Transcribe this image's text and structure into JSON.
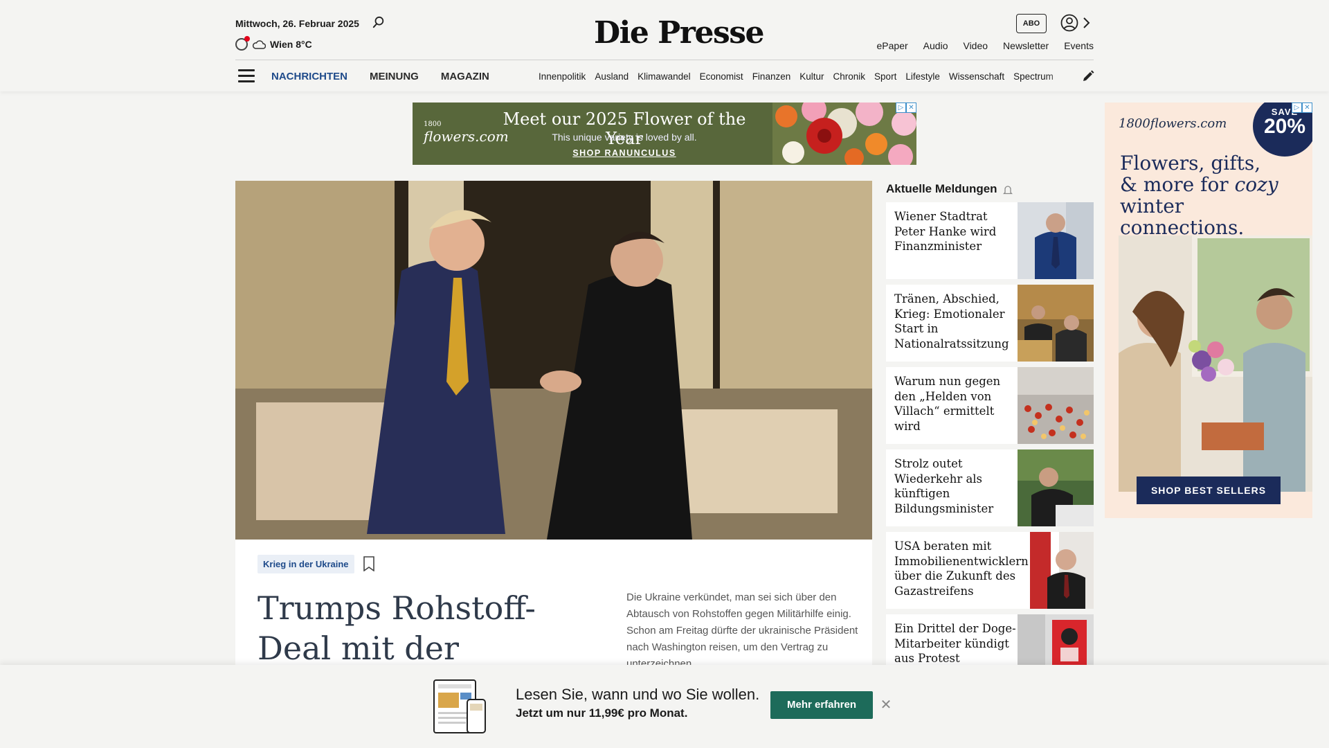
{
  "header": {
    "date": "Mittwoch, 26. Februar 2025",
    "weather": "Wien 8°C",
    "logo": "Die Presse",
    "abo_label": "ABO",
    "top_links": [
      "ePaper",
      "Audio",
      "Video",
      "Newsletter",
      "Events"
    ],
    "main_nav": [
      "NACHRICHTEN",
      "MEINUNG",
      "MAGAZIN"
    ],
    "sub_nav": [
      "Innenpolitik",
      "Ausland",
      "Klimawandel",
      "Economist",
      "Finanzen",
      "Kultur",
      "Chronik",
      "Sport",
      "Lifestyle",
      "Wissenschaft",
      "Spectrum"
    ]
  },
  "top_ad": {
    "brand": "1800flowers.com",
    "headline": "Meet our 2025 Flower of the Year",
    "sub": "This unique variety is loved by all.",
    "cta": "SHOP RANUNCULUS"
  },
  "article": {
    "tag": "Krieg in der Ukraine",
    "title": "Trumps Rohstoff-Deal mit der Ukraine: Was",
    "lead": "Die Ukraine verkündet, man sei sich über den Abtausch von Rohstoffen gegen Militärhilfe einig. Schon am Freitag dürfte der ukrainische Präsident nach Washington reisen, um den Vertrag zu unterzeichnen."
  },
  "sidebar": {
    "title": "Aktuelle Meldungen",
    "items": [
      {
        "text": "Wiener Stadtrat Peter Hanke wird Finanzminister"
      },
      {
        "text": "Tränen, Abschied, Krieg: Emotionaler Start in Nationalratssitzung"
      },
      {
        "text": "Warum nun gegen den „Helden von Villach“ ermittelt wird"
      },
      {
        "text": "Strolz outet Wiederkehr als künftigen Bildungsminister"
      },
      {
        "text": "USA beraten mit Immobilienentwicklern über die Zukunft des Gazastreifens"
      },
      {
        "text": "Ein Drittel der Doge-Mitarbeiter kündigt aus Protest"
      }
    ]
  },
  "right_ad": {
    "brand": "1800flowers.com",
    "save_label": "SAVE",
    "save_value": "20%",
    "headline_1": "Flowers, gifts,",
    "headline_2a": "& more for ",
    "headline_2b": "cozy",
    "headline_3": "winter connections.",
    "cta": "SHOP BEST SELLERS"
  },
  "bottom_banner": {
    "line1": "Lesen Sie, wann und wo Sie wollen.",
    "line2": "Jetzt um nur 11,99€ pro Monat.",
    "button": "Mehr erfahren",
    "close": "✕"
  },
  "colors": {
    "nav_active": "#1e4a8a",
    "headline": "#2f3a4a",
    "cta_green": "#1d6b5a",
    "ad_navy": "#1b2b5a",
    "ad_olive": "#58673b"
  }
}
